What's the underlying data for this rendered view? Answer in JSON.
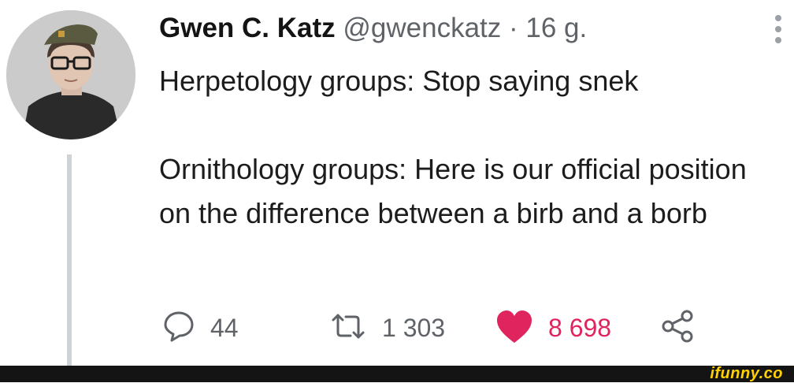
{
  "tweet": {
    "author_name": "Gwen C. Katz",
    "author_handle": "@gwenckatz",
    "separator": "·",
    "timestamp": "16 g.",
    "paragraphs": [
      "Herpetology groups: Stop saying snek",
      "Ornithology groups: Here is our official position on the difference between a birb and a borb"
    ]
  },
  "actions": {
    "reply_count": "44",
    "retweet_count": "1 303",
    "like_count": "8 698",
    "reply_icon": "speech-bubble-icon",
    "retweet_icon": "retweet-arrows-icon",
    "like_icon": "heart-icon",
    "share_icon": "share-nodes-icon"
  },
  "colors": {
    "like": "#e0245e",
    "muted": "#5f6368",
    "watermark": "#ffd200"
  },
  "watermark": "ifunny.co"
}
